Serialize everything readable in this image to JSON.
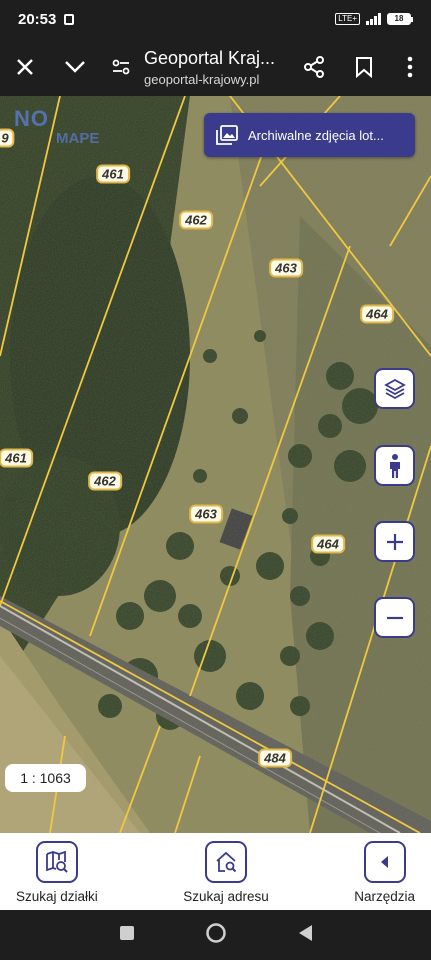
{
  "status": {
    "time": "20:53",
    "network": "LTE+",
    "battery": "18"
  },
  "browser": {
    "title": "Geoportal Kraj...",
    "url": "geoportal-krajowy.pl"
  },
  "map": {
    "watermark": "NO",
    "watermark_sub": "MAPE",
    "archive_button_label": "Archiwalne zdjęcia lot...",
    "scale": "1 : 1063",
    "parcels": [
      "461",
      "462",
      "463",
      "464",
      "461",
      "462",
      "463",
      "464",
      "484",
      "9"
    ]
  },
  "bottom_bar": {
    "search_parcel": "Szukaj działki",
    "search_address": "Szukaj adresu",
    "tools": "Narzędzia"
  },
  "colors": {
    "accent": "#3b3b8e",
    "parcel_border": "#e0b84a"
  }
}
